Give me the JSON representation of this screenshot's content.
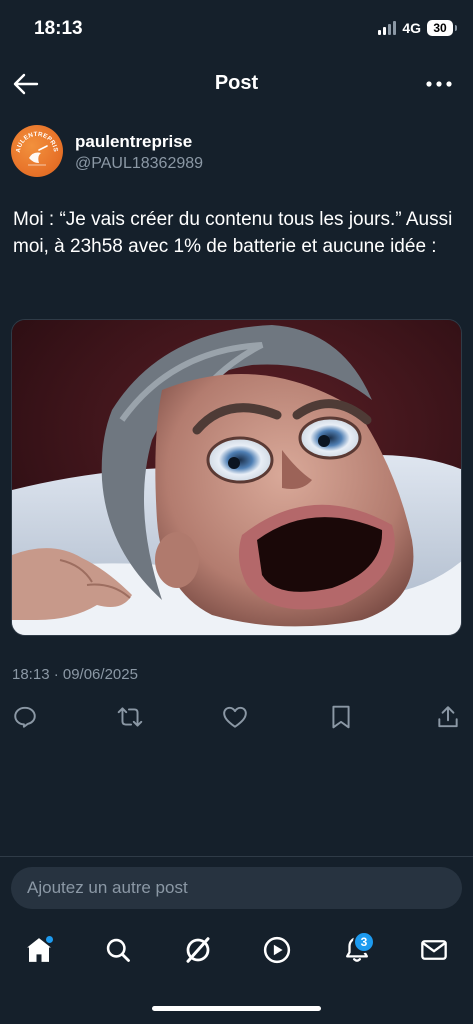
{
  "status_bar": {
    "time": "18:13",
    "network": "4G",
    "battery": "30"
  },
  "header": {
    "title": "Post"
  },
  "author": {
    "name": "paulentreprise",
    "handle": "@PAUL18362989",
    "avatar_text": "PAULENTREPRISE"
  },
  "post": {
    "text": "Moi : “Je vais créer du contenu tous les jours.” Aussi moi, à 23h58 avec 1% de batterie et aucune idée :",
    "timestamp": "18:13 · 09/06/2025"
  },
  "actions": [
    "reply-icon",
    "repost-icon",
    "like-icon",
    "bookmark-icon",
    "share-icon"
  ],
  "reply": {
    "placeholder": "Ajoutez un autre post"
  },
  "tabs": {
    "items": [
      "home-icon",
      "search-icon",
      "grok-icon",
      "video-icon",
      "notifications-icon",
      "messages-icon"
    ],
    "notifications_count": "3"
  },
  "colors": {
    "background": "#15202b",
    "accent": "#1d9bf0",
    "muted": "#8b98a5",
    "avatar": "#e8742a"
  }
}
